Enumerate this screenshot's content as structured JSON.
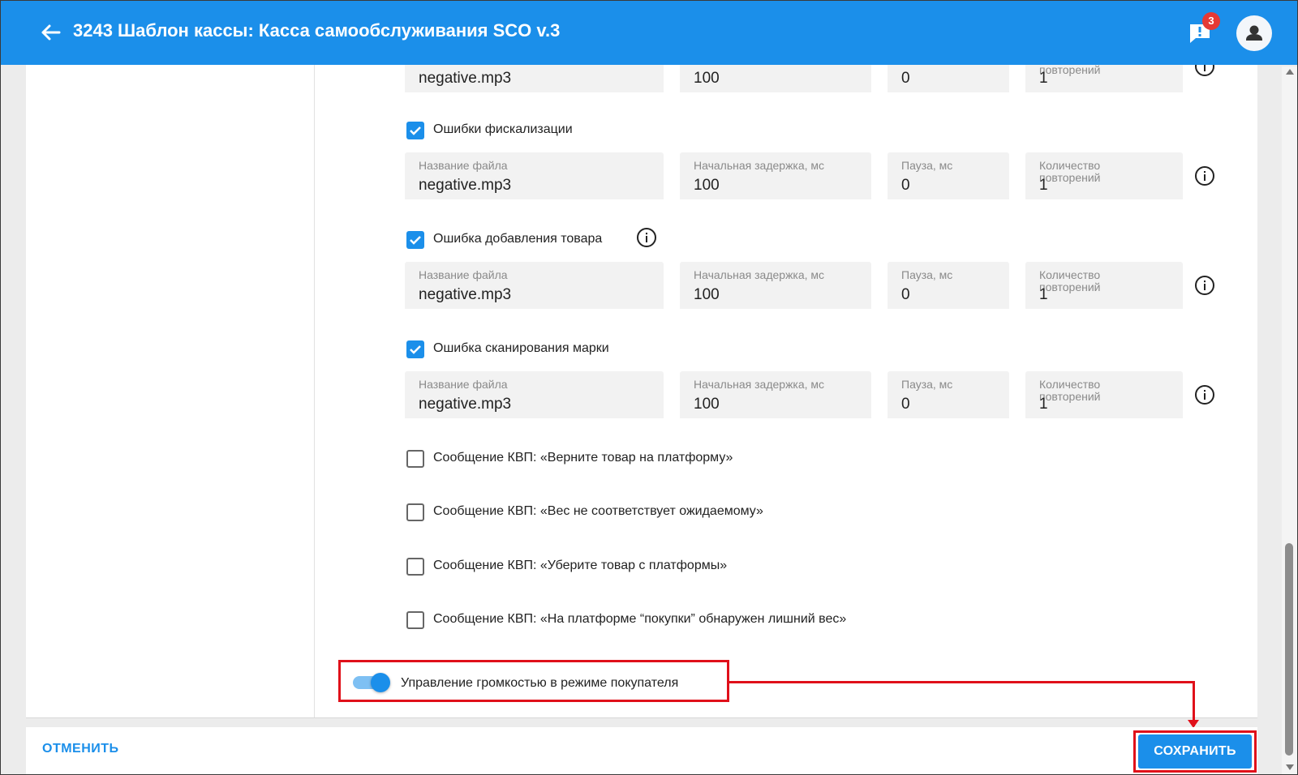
{
  "header": {
    "title": "3243 Шаблон кассы: Касса самообслуживания SCO v.3",
    "notification_count": "3"
  },
  "labels": {
    "file_name": "Название файла",
    "initial_delay": "Начальная задержка, мс",
    "pause": "Пауза, мс",
    "repeat_count": "Количество повторений"
  },
  "top_row": {
    "file_name": "negative.mp3",
    "initial_delay": "100",
    "pause": "0",
    "repeat_count_label": "повторений",
    "repeat_count": "1"
  },
  "sections": [
    {
      "label": "Ошибки фискализации",
      "checked": true,
      "file_name": "negative.mp3",
      "initial_delay": "100",
      "pause": "0",
      "repeat_count": "1"
    },
    {
      "label": "Ошибка добавления товара",
      "checked": true,
      "file_name": "negative.mp3",
      "initial_delay": "100",
      "pause": "0",
      "repeat_count": "1"
    },
    {
      "label": "Ошибка сканирования марки",
      "checked": true,
      "file_name": "negative.mp3",
      "initial_delay": "100",
      "pause": "0",
      "repeat_count": "1"
    }
  ],
  "messages": [
    {
      "label": "Сообщение КВП: «Верните товар на платформу»",
      "checked": false
    },
    {
      "label": "Сообщение КВП: «Вес не соответствует ожидаемому»",
      "checked": false
    },
    {
      "label": "Сообщение КВП: «Уберите товар с платформы»",
      "checked": false
    },
    {
      "label": "Сообщение КВП: «На платформе “покупки” обнаружен лишний вес»",
      "checked": false
    }
  ],
  "volume_toggle": {
    "label": "Управление громкостью в режиме покупателя",
    "enabled": true
  },
  "footer": {
    "cancel_label": "ОТМЕНИТЬ",
    "save_label": "СОХРАНИТЬ"
  },
  "colors": {
    "primary": "#1b8fea",
    "annotation": "#e0101a",
    "badge": "#e53935"
  },
  "icons": {
    "back": "arrow-left-icon",
    "chat": "chat-alert-icon",
    "avatar": "user-icon",
    "info": "info-circle-icon",
    "check": "check-icon"
  }
}
